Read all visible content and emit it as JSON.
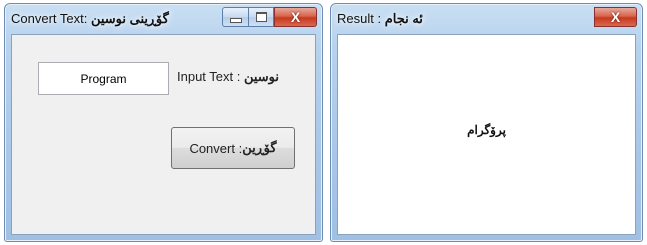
{
  "converter_window": {
    "title_prefix": "Convert Text: ",
    "title_suffix": "گۆڕینی نوسین",
    "textbox_value": "Program",
    "input_label_en": "Input Text : ",
    "input_label_ku": "نوسین",
    "convert_en": "Convert : ",
    "convert_ku": "گۆڕین",
    "close_glyph": "X"
  },
  "result_window": {
    "title_prefix": "Result : ",
    "title_suffix": "ئه نجام",
    "result_text": "پرۆگرام",
    "close_glyph": "X"
  },
  "icons": [
    "minimize-icon",
    "maximize-icon",
    "close-icon"
  ],
  "colors": {
    "close_button": "#c73a1f",
    "frame": "#a9c7e8"
  }
}
